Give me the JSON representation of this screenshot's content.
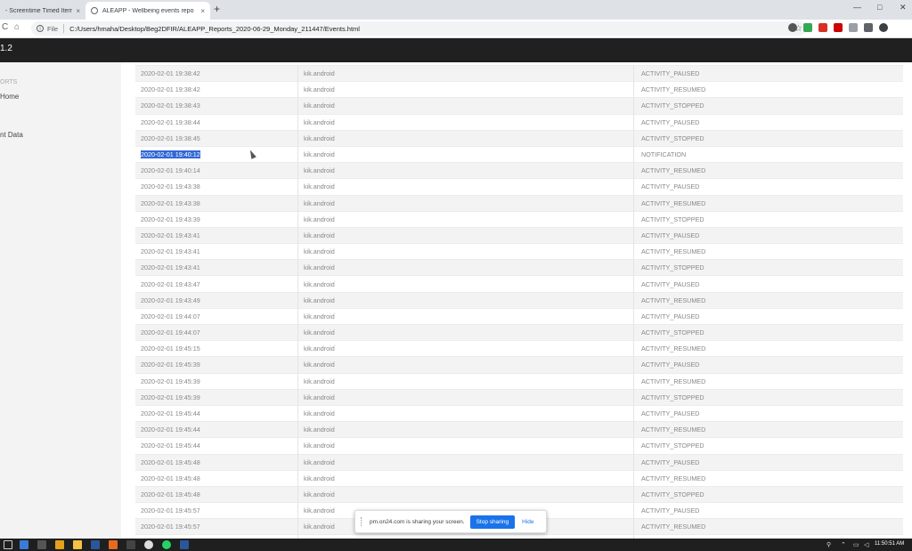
{
  "browser": {
    "tabs": [
      {
        "title": "- Screentime Timed Item",
        "close": "×",
        "active": false
      },
      {
        "title": "ALEAPP - Wellbeing events repo",
        "close": "×",
        "active": true
      }
    ],
    "new_tab": "+",
    "window_controls": {
      "minimize": "—",
      "maximize": "□",
      "close": "✕"
    },
    "nav": {
      "back": "C",
      "home": "⌂"
    },
    "address": {
      "info": "i",
      "scheme_label": "File",
      "url": "C:/Users/hmaha/Desktop/Beg2DFIR/ALEAPP_Reports_2020-06-29_Monday_211447/Events.html"
    },
    "star": "☆",
    "extension_colors": [
      "#555555",
      "#34a853",
      "#d93025",
      "#cc0000",
      "#9aa0a6",
      "#5f6368",
      "#3c4043"
    ]
  },
  "app": {
    "title": "1.2"
  },
  "sidebar": {
    "section": "ORTS",
    "items": [
      {
        "label": "Home"
      },
      {
        "label": "nt Data"
      }
    ]
  },
  "table": {
    "rows": [
      {
        "ts": "2020-02-01 19:38:42",
        "pkg": "kik.android",
        "event": "ACTIVITY_PAUSED"
      },
      {
        "ts": "2020-02-01 19:38:42",
        "pkg": "kik.android",
        "event": "ACTIVITY_RESUMED"
      },
      {
        "ts": "2020-02-01 19:38:43",
        "pkg": "kik.android",
        "event": "ACTIVITY_STOPPED"
      },
      {
        "ts": "2020-02-01 19:38:44",
        "pkg": "kik.android",
        "event": "ACTIVITY_PAUSED"
      },
      {
        "ts": "2020-02-01 19:38:45",
        "pkg": "kik.android",
        "event": "ACTIVITY_STOPPED"
      },
      {
        "ts": "2020-02-01 19:40:12",
        "pkg": "kik.android",
        "event": "NOTIFICATION",
        "selected": true
      },
      {
        "ts": "2020-02-01 19:40:14",
        "pkg": "kik.android",
        "event": "ACTIVITY_RESUMED"
      },
      {
        "ts": "2020-02-01 19:43:38",
        "pkg": "kik.android",
        "event": "ACTIVITY_PAUSED"
      },
      {
        "ts": "2020-02-01 19:43:38",
        "pkg": "kik.android",
        "event": "ACTIVITY_RESUMED"
      },
      {
        "ts": "2020-02-01 19:43:39",
        "pkg": "kik.android",
        "event": "ACTIVITY_STOPPED"
      },
      {
        "ts": "2020-02-01 19:43:41",
        "pkg": "kik.android",
        "event": "ACTIVITY_PAUSED"
      },
      {
        "ts": "2020-02-01 19:43:41",
        "pkg": "kik.android",
        "event": "ACTIVITY_RESUMED"
      },
      {
        "ts": "2020-02-01 19:43:41",
        "pkg": "kik.android",
        "event": "ACTIVITY_STOPPED"
      },
      {
        "ts": "2020-02-01 19:43:47",
        "pkg": "kik.android",
        "event": "ACTIVITY_PAUSED"
      },
      {
        "ts": "2020-02-01 19:43:49",
        "pkg": "kik.android",
        "event": "ACTIVITY_RESUMED"
      },
      {
        "ts": "2020-02-01 19:44:07",
        "pkg": "kik.android",
        "event": "ACTIVITY_PAUSED"
      },
      {
        "ts": "2020-02-01 19:44:07",
        "pkg": "kik.android",
        "event": "ACTIVITY_STOPPED"
      },
      {
        "ts": "2020-02-01 19:45:15",
        "pkg": "kik.android",
        "event": "ACTIVITY_RESUMED"
      },
      {
        "ts": "2020-02-01 19:45:39",
        "pkg": "kik.android",
        "event": "ACTIVITY_PAUSED"
      },
      {
        "ts": "2020-02-01 19:45:39",
        "pkg": "kik.android",
        "event": "ACTIVITY_RESUMED"
      },
      {
        "ts": "2020-02-01 19:45:39",
        "pkg": "kik.android",
        "event": "ACTIVITY_STOPPED"
      },
      {
        "ts": "2020-02-01 19:45:44",
        "pkg": "kik.android",
        "event": "ACTIVITY_PAUSED"
      },
      {
        "ts": "2020-02-01 19:45:44",
        "pkg": "kik.android",
        "event": "ACTIVITY_RESUMED"
      },
      {
        "ts": "2020-02-01 19:45:44",
        "pkg": "kik.android",
        "event": "ACTIVITY_STOPPED"
      },
      {
        "ts": "2020-02-01 19:45:48",
        "pkg": "kik.android",
        "event": "ACTIVITY_PAUSED"
      },
      {
        "ts": "2020-02-01 19:45:48",
        "pkg": "kik.android",
        "event": "ACTIVITY_RESUMED"
      },
      {
        "ts": "2020-02-01 19:45:48",
        "pkg": "kik.android",
        "event": "ACTIVITY_STOPPED"
      },
      {
        "ts": "2020-02-01 19:45:57",
        "pkg": "kik.android",
        "event": "ACTIVITY_PAUSED"
      },
      {
        "ts": "2020-02-01 19:45:57",
        "pkg": "kik.android",
        "event": "ACTIVITY_RESUMED"
      },
      {
        "ts": "2020-02-01 19:45:58",
        "pkg": "kik.android",
        "event": "ACTIVITY_STOPPED"
      },
      {
        "ts": "2020-02-01 19:46:01",
        "pkg": "kik.android",
        "event": "ACTIVITY_PAUSED"
      }
    ]
  },
  "share_bar": {
    "message": "pm.on24.com is sharing your screen.",
    "stop_label": "Stop sharing",
    "hide_label": "Hide"
  },
  "taskbar": {
    "clock": "11:50:51 AM",
    "icon_colors": [
      "#3a7bd5",
      "#555555",
      "#e3a21a",
      "#f5c242",
      "#2b579a",
      "#e86a1c",
      "#444444",
      "#dddddd",
      "#25d366",
      "#2b579a"
    ]
  }
}
